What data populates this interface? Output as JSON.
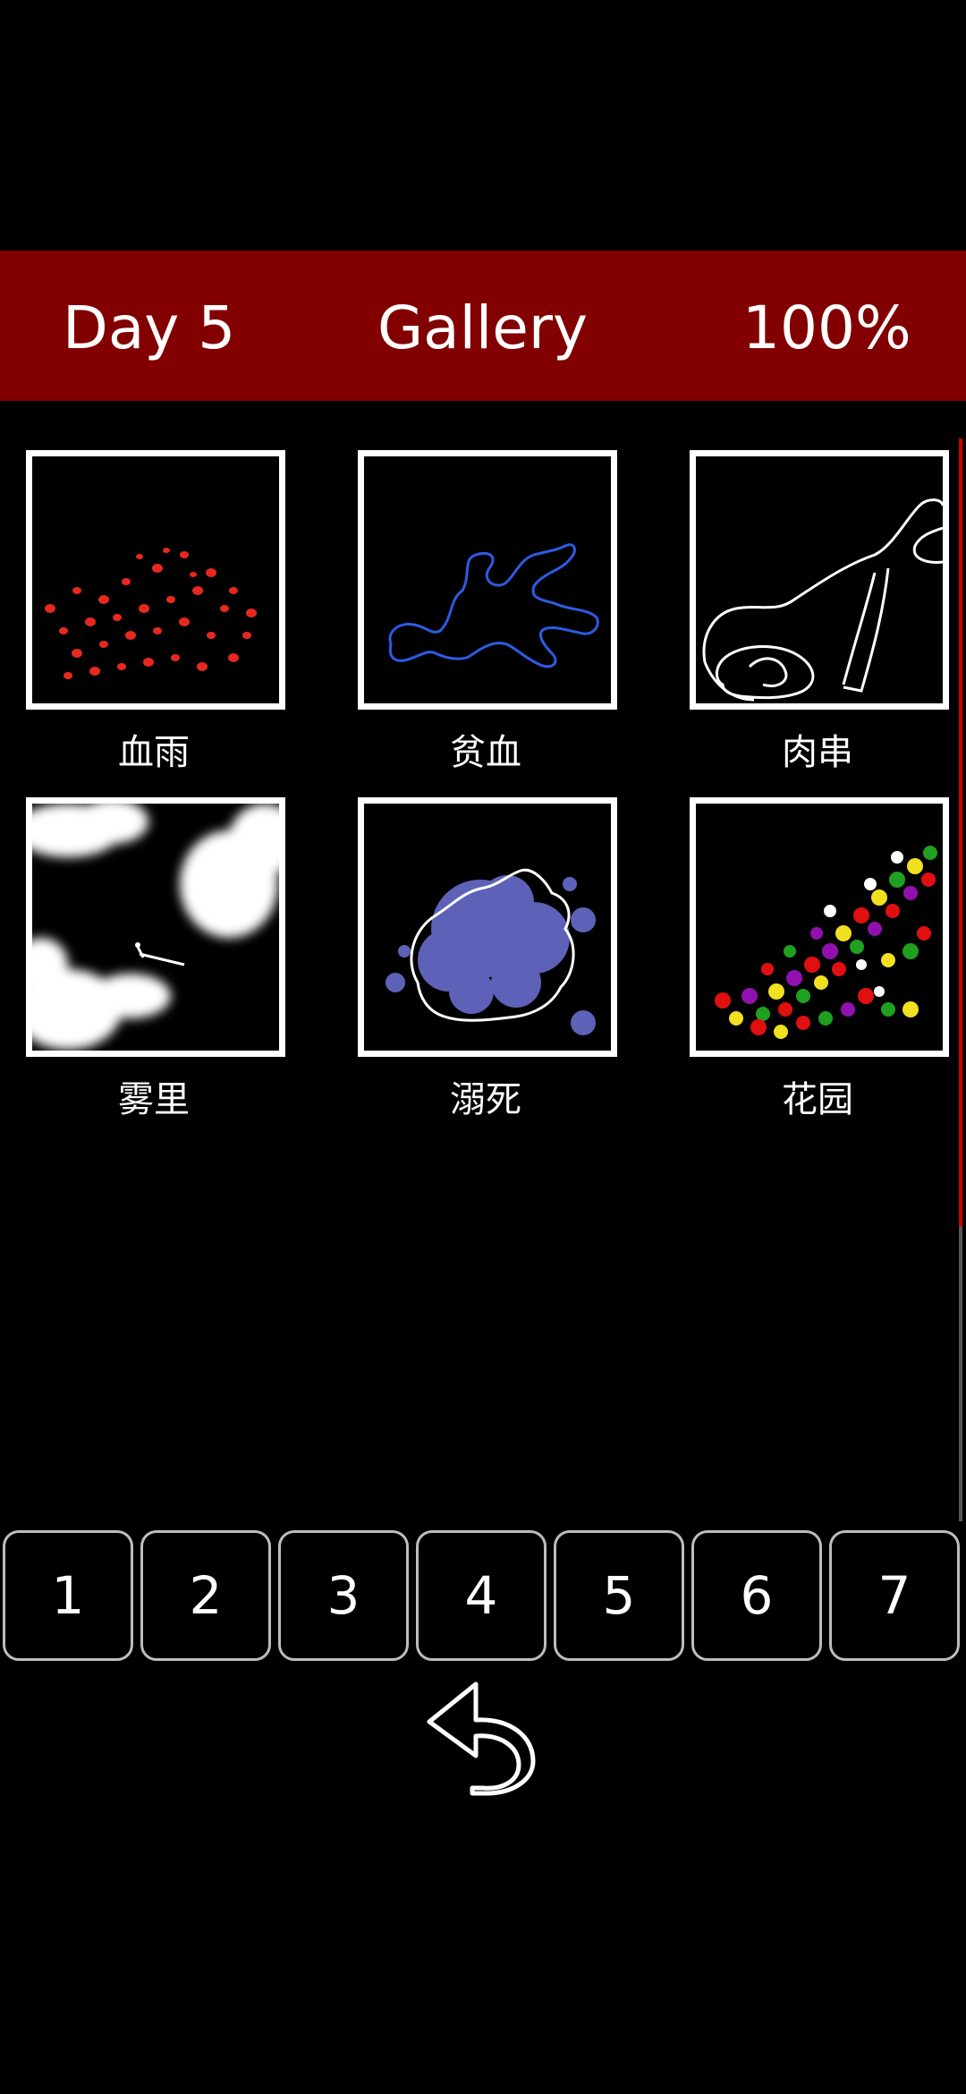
{
  "header": {
    "day": "Day 5",
    "title": "Gallery",
    "progress": "100%"
  },
  "gallery": [
    {
      "label": "血雨"
    },
    {
      "label": "贫血"
    },
    {
      "label": "肉串"
    },
    {
      "label": "雾里"
    },
    {
      "label": "溺死"
    },
    {
      "label": "花园"
    }
  ],
  "pages": [
    "1",
    "2",
    "3",
    "4",
    "5",
    "6",
    "7"
  ],
  "colors": {
    "header_bg": "#820000",
    "scroll_thumb": "#cc0000"
  },
  "icons": {
    "back": "undo-arrow-icon"
  }
}
